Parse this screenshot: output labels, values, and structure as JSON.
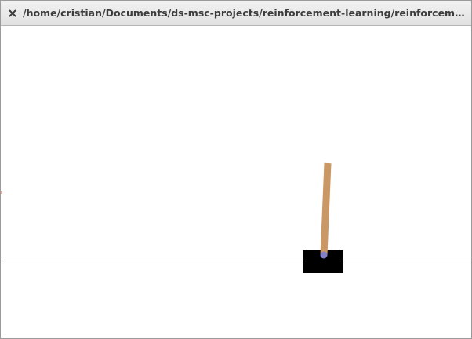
{
  "window": {
    "title": "/home/cristian/Documents/ds-msc-projects/reinforcement-learning/reinforcement-learning-...",
    "close_icon": "close-icon"
  },
  "render": {
    "background_color": "#ffffff",
    "track_color": "#000000",
    "cart_color": "#000000",
    "pole_color": "#ca9865",
    "axle_color": "#8180cb"
  }
}
